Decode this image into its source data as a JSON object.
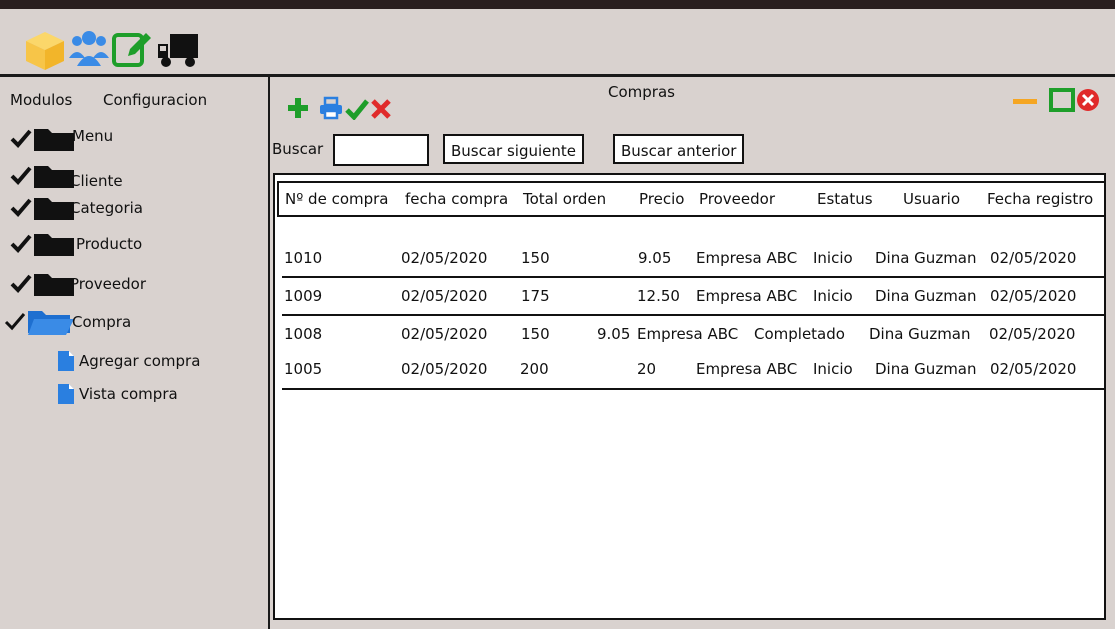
{
  "window": {
    "title": "Compras"
  },
  "top_icons": [
    "box-icon",
    "users-icon",
    "edit-icon",
    "truck-icon"
  ],
  "menu": {
    "modulos": "Modulos",
    "configuracion": "Configuracion"
  },
  "tree": {
    "items": [
      {
        "label": "Menu"
      },
      {
        "label": "Cliente"
      },
      {
        "label": "Categoria"
      },
      {
        "label": "Producto"
      },
      {
        "label": "Proveedor"
      },
      {
        "label": "Compra"
      }
    ],
    "sub_items": [
      {
        "label": "Agregar compra"
      },
      {
        "label": "Vista compra"
      }
    ]
  },
  "search": {
    "label": "Buscar",
    "value": "",
    "next_button": "Buscar siguiente",
    "prev_button": "Buscar anterior"
  },
  "table": {
    "headers": [
      "Nº de compra",
      "fecha compra",
      "Total orden",
      "Precio",
      "Proveedor",
      "Estatus",
      "Usuario",
      "Fecha registro"
    ],
    "rows": [
      [
        "1010",
        "02/05/2020",
        "150",
        "9.05",
        "Empresa ABC",
        "Inicio",
        "Dina Guzman",
        "02/05/2020"
      ],
      [
        "1009",
        "02/05/2020",
        "175",
        "12.50",
        "Empresa ABC",
        "Inicio",
        "Dina Guzman",
        "02/05/2020"
      ],
      [
        "1008",
        "02/05/2020",
        "150",
        "9.05",
        "Empresa ABC",
        "Completado",
        "Dina Guzman",
        "02/05/2020"
      ],
      [
        "1005",
        "02/05/2020",
        "200",
        "20",
        "Empresa ABC",
        "Inicio",
        "Dina Guzman",
        "02/05/2020"
      ]
    ]
  },
  "colors": {
    "background": "#d9d2cf",
    "accent_green": "#1e9e2a",
    "accent_blue": "#2a7fe0",
    "close_red": "#e02a2a",
    "minimize_orange": "#f5a623",
    "folder_blue": "#2a7fe0"
  }
}
